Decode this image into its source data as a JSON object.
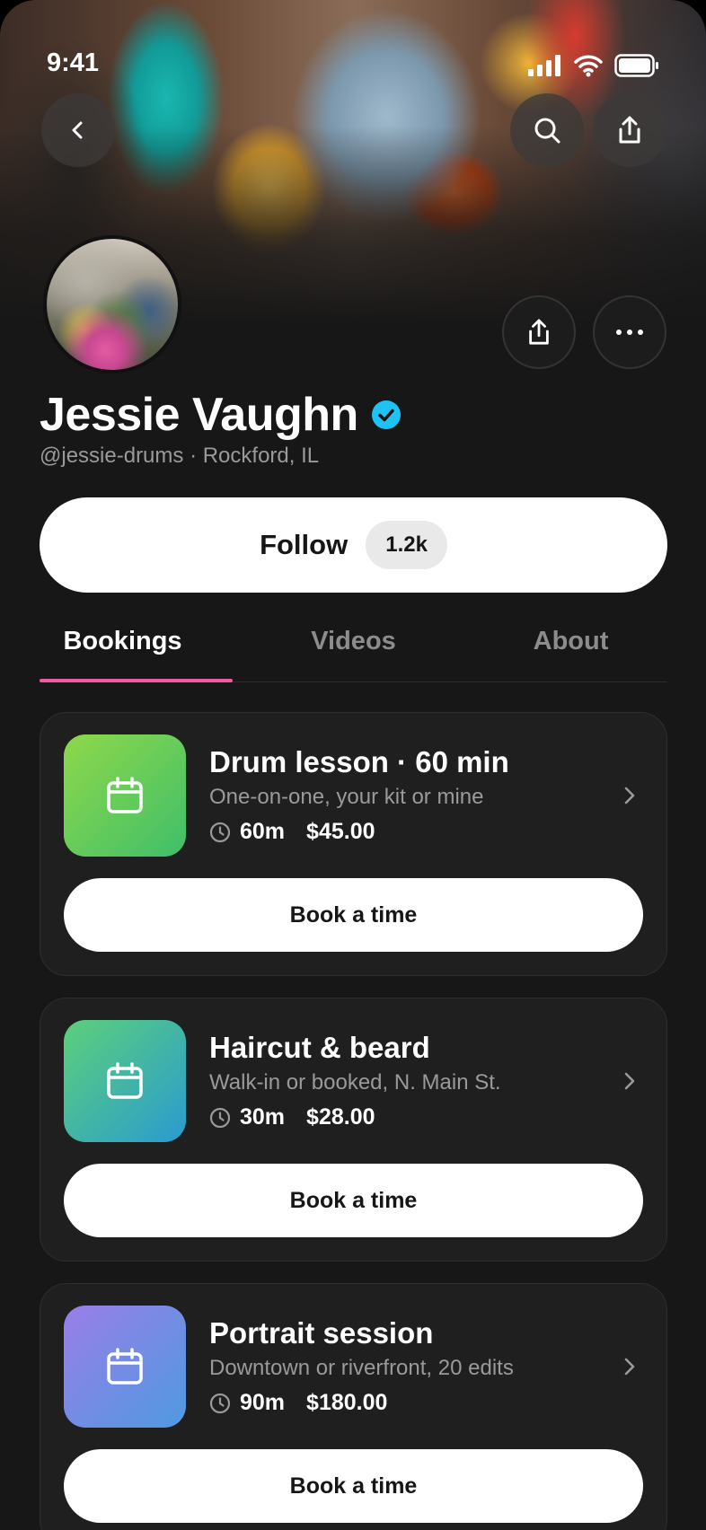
{
  "status_bar": {
    "time": "9:41"
  },
  "profile": {
    "name": "Jessie Vaughn",
    "handle_location": "@jessie-drums · Rockford, IL",
    "verified": true
  },
  "follow": {
    "label": "Follow",
    "count": "1.2k"
  },
  "tabs": [
    {
      "label": "Bookings",
      "active": true
    },
    {
      "label": "Videos",
      "active": false
    },
    {
      "label": "About",
      "active": false
    }
  ],
  "bookings": [
    {
      "title": "Drum lesson · 60 min",
      "description": "One-on-one, your kit or mine",
      "duration": "60m",
      "price": "$45.00",
      "button": "Book a time",
      "colors": [
        "#8fd84a",
        "#3fbf6a"
      ]
    },
    {
      "title": "Haircut & beard",
      "description": "Walk-in or booked, N. Main St.",
      "duration": "30m",
      "price": "$28.00",
      "button": "Book a time",
      "colors": [
        "#5cd07a",
        "#2a9bd0"
      ]
    },
    {
      "title": "Portrait session",
      "description": "Downtown or riverfront, 20 edits",
      "duration": "90m",
      "price": "$180.00",
      "button": "Book a time",
      "colors": [
        "#9a7ee8",
        "#4f9ae0"
      ]
    }
  ],
  "colors": {
    "background": "#171717",
    "accent_underline": "#ef5aa0",
    "verified_badge": "#1ec3f5"
  },
  "icons": {
    "back": "chevron-left-icon",
    "search": "search-icon",
    "share": "share-icon",
    "more": "more-horizontal-icon",
    "card": "calendar-icon",
    "clock": "clock-icon",
    "chevron": "chevron-right-icon"
  }
}
